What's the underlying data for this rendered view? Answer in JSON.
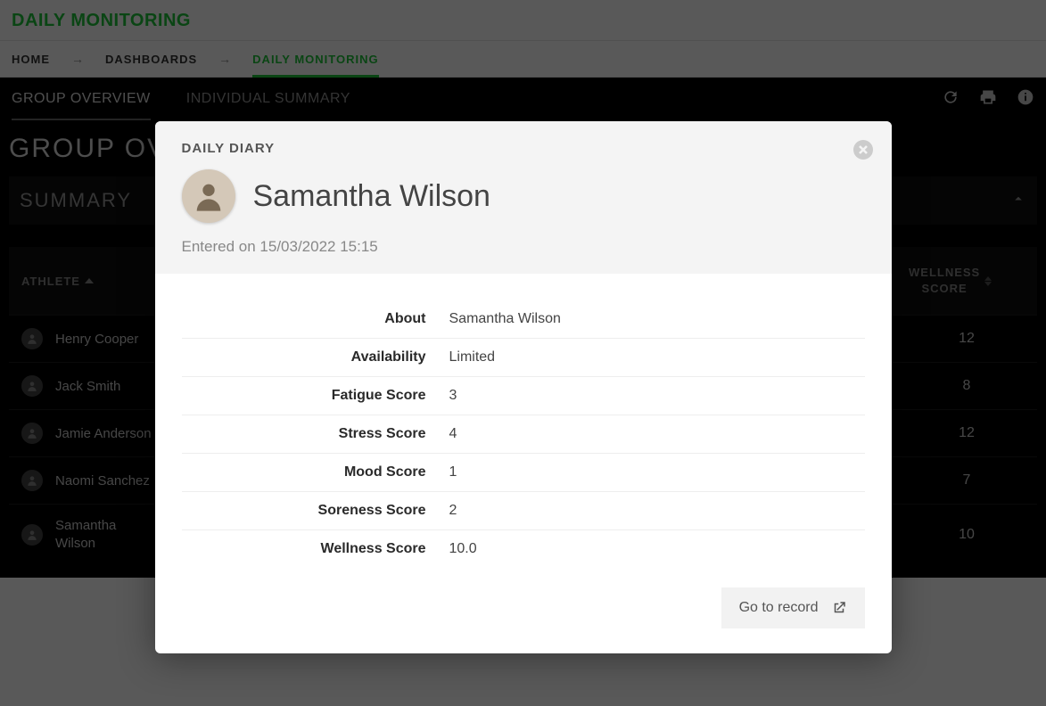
{
  "header": {
    "title": "DAILY MONITORING"
  },
  "breadcrumb": {
    "home": "HOME",
    "dashboards": "DASHBOARDS",
    "current": "DAILY MONITORING"
  },
  "subnav": {
    "tab1": "GROUP OVERVIEW",
    "tab2": "INDIVIDUAL SUMMARY"
  },
  "page": {
    "group_title": "GROUP OVERVIEW",
    "summary_label": "SUMMARY"
  },
  "table": {
    "col_athlete": "ATHLETE",
    "col_wellness_line1": "WELLNESS",
    "col_wellness_line2": "SCORE",
    "rows": [
      {
        "name": "Henry Cooper",
        "score": "12"
      },
      {
        "name": "Jack Smith",
        "score": "8"
      },
      {
        "name": "Jamie Anderson",
        "score": "12"
      },
      {
        "name": "Naomi Sanchez",
        "score": "7"
      },
      {
        "name": "Samantha Wilson",
        "score": "10"
      }
    ]
  },
  "modal": {
    "diary_label": "DAILY DIARY",
    "person_name": "Samantha Wilson",
    "entered_prefix": "Entered on ",
    "entered_time": "15/03/2022 15:15",
    "details": [
      {
        "label": "About",
        "value": "Samantha Wilson"
      },
      {
        "label": "Availability",
        "value": "Limited"
      },
      {
        "label": "Fatigue Score",
        "value": "3"
      },
      {
        "label": "Stress Score",
        "value": "4"
      },
      {
        "label": "Mood Score",
        "value": "1"
      },
      {
        "label": "Soreness Score",
        "value": "2"
      },
      {
        "label": "Wellness Score",
        "value": "10.0"
      }
    ],
    "go_record": "Go to record"
  }
}
